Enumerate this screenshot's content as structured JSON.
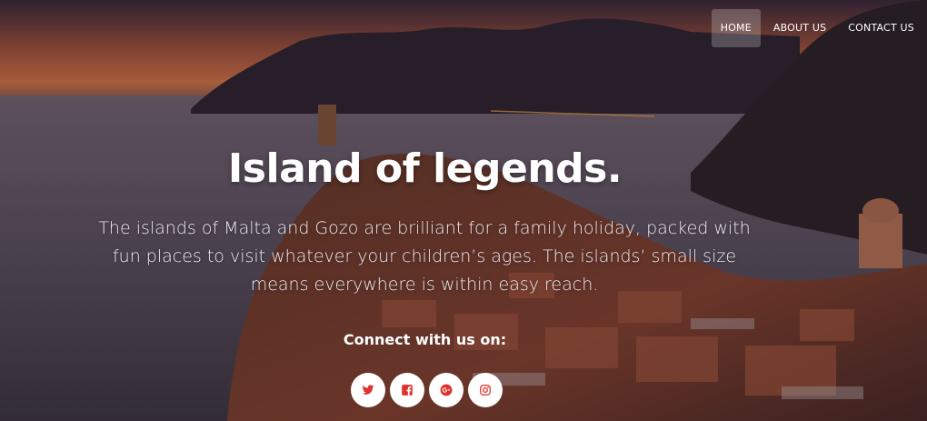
{
  "nav": {
    "items": [
      {
        "label": "HOME",
        "active": true
      },
      {
        "label": "ABOUT US",
        "active": false
      },
      {
        "label": "CONTACT US",
        "active": false
      }
    ]
  },
  "hero": {
    "title": "Island of legends.",
    "description": "The islands of Malta and Gozo are brilliant for a family holiday, packed with fun places to visit whatever your children’s ages. The islands’ small size means everywhere is within easy reach.",
    "connect_label": "Connect with us on:"
  },
  "socials": [
    {
      "icon": "twitter-icon"
    },
    {
      "icon": "facebook-icon"
    },
    {
      "icon": "google-plus-icon"
    },
    {
      "icon": "instagram-icon"
    }
  ],
  "colors": {
    "accent": "#e0322d",
    "icon_red": "#e0322d",
    "button_bg": "#ffffff",
    "text": "#ffffff"
  }
}
